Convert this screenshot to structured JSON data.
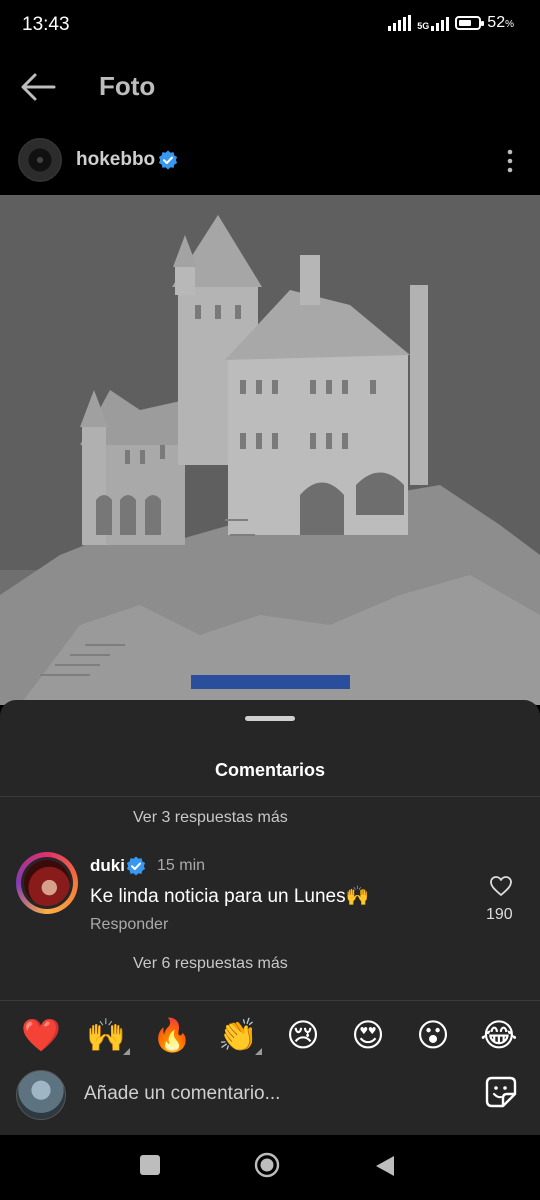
{
  "status_bar": {
    "time": "13:43",
    "network": "5G",
    "battery_text": "52",
    "battery_unit": "%",
    "battery_level": 0.52
  },
  "header": {
    "title": "Foto",
    "back_icon": "arrow-left-icon"
  },
  "post": {
    "username": "hokebbo",
    "verified": true
  },
  "photo": {
    "subject": "sand-castle-image"
  },
  "comments_sheet": {
    "title": "Comentarios",
    "more_replies_top": "Ver 3 respuestas más",
    "comment": {
      "username": "duki",
      "verified": true,
      "time": "15 min",
      "text": "Ke linda noticia para un Lunes🙌",
      "reply_label": "Responder",
      "likes": "190"
    },
    "more_replies_bottom": "Ver 6 respuestas más"
  },
  "quick_emojis": [
    {
      "name": "red-heart",
      "char": "❤️",
      "has_variants": false
    },
    {
      "name": "raising-hands",
      "char": "🙌",
      "has_variants": true
    },
    {
      "name": "fire",
      "char": "🔥",
      "has_variants": false
    },
    {
      "name": "clapping-hands",
      "char": "👏",
      "has_variants": true
    },
    {
      "name": "crying-face",
      "char": "😢",
      "has_variants": false
    },
    {
      "name": "heart-eyes",
      "char": "😍",
      "has_variants": false
    },
    {
      "name": "astonished-face",
      "char": "😮",
      "has_variants": false
    },
    {
      "name": "tears-of-joy",
      "char": "😂",
      "has_variants": false
    }
  ],
  "comment_input": {
    "placeholder": "Añade un comentario..."
  },
  "colors": {
    "verified_blue": "#3897f0",
    "sheet_bg": "#262626",
    "ad_bar": "#2b4e9c"
  }
}
